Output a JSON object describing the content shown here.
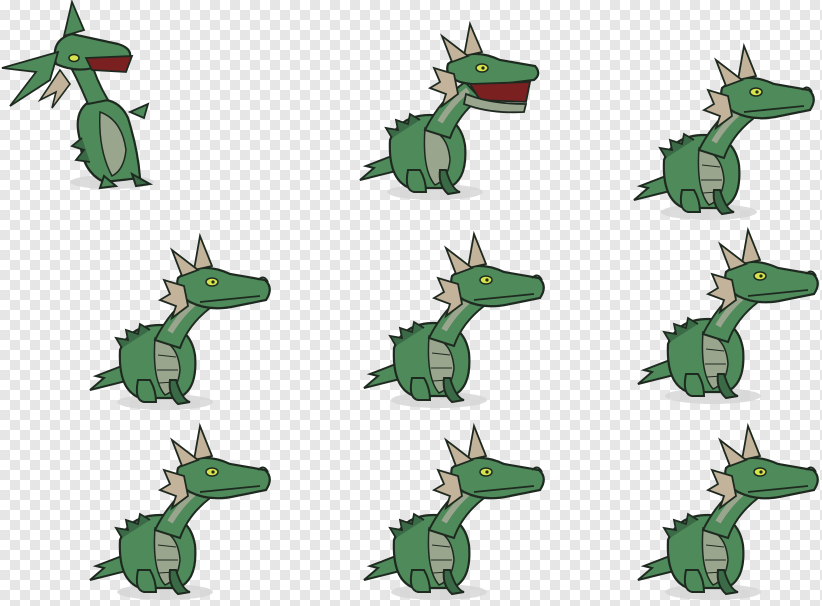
{
  "sprite_sheet": {
    "subject": "green-dragon-sprite",
    "colors": {
      "body": "#4e8a5a",
      "body_dark": "#3a6b46",
      "belly": "#9aa58e",
      "frill": "#c3b39a",
      "outline": "#1e2a20",
      "mouth": "#7a2020",
      "eye": "#d6e34a",
      "shadow": "#d4d4d4"
    },
    "frames": [
      {
        "pose": "roar-up"
      },
      {
        "pose": "roar"
      },
      {
        "pose": "idle"
      },
      {
        "pose": "idle"
      },
      {
        "pose": "idle"
      },
      {
        "pose": "idle"
      },
      {
        "pose": "idle"
      },
      {
        "pose": "idle"
      },
      {
        "pose": "idle"
      }
    ]
  }
}
